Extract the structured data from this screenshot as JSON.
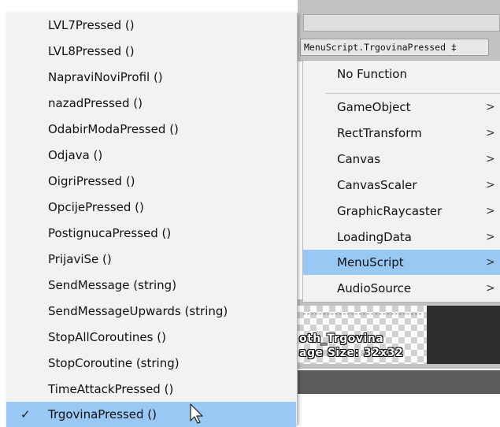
{
  "inspector": {
    "function_field": "MenuScript.TrgovinaPressed ‡",
    "preview_line1": "oth_Trgovina",
    "preview_line2": "age Size: 32x32"
  },
  "menu_left": {
    "items": [
      {
        "label": "LVL7Pressed ()",
        "checked": false
      },
      {
        "label": "LVL8Pressed ()",
        "checked": false
      },
      {
        "label": "NapraviNoviProfil ()",
        "checked": false
      },
      {
        "label": "nazadPressed ()",
        "checked": false
      },
      {
        "label": "OdabirModaPressed ()",
        "checked": false
      },
      {
        "label": "Odjava ()",
        "checked": false
      },
      {
        "label": "OigriPressed ()",
        "checked": false
      },
      {
        "label": "OpcijePressed ()",
        "checked": false
      },
      {
        "label": "PostignucaPressed ()",
        "checked": false
      },
      {
        "label": "PrijaviSe ()",
        "checked": false
      },
      {
        "label": "SendMessage (string)",
        "checked": false
      },
      {
        "label": "SendMessageUpwards (string)",
        "checked": false
      },
      {
        "label": "StopAllCoroutines ()",
        "checked": false
      },
      {
        "label": "StopCoroutine (string)",
        "checked": false
      },
      {
        "label": "TimeAttackPressed ()",
        "checked": false
      },
      {
        "label": "TrgovinaPressed ()",
        "checked": true
      }
    ],
    "check_glyph": "✓"
  },
  "menu_right": {
    "no_function": "No Function",
    "components": [
      {
        "label": "GameObject"
      },
      {
        "label": "RectTransform"
      },
      {
        "label": "Canvas"
      },
      {
        "label": "CanvasScaler"
      },
      {
        "label": "GraphicRaycaster"
      },
      {
        "label": "LoadingData"
      },
      {
        "label": "MenuScript"
      },
      {
        "label": "AudioSource"
      }
    ],
    "arrow_glyph": ">"
  },
  "colors": {
    "highlight": "#99c8f5",
    "menu_bg": "#f2f2f2"
  },
  "icons": {
    "submenu_arrow": "chevron-right-icon",
    "selected_check": "check-icon",
    "pointer": "mouse-cursor-icon"
  }
}
